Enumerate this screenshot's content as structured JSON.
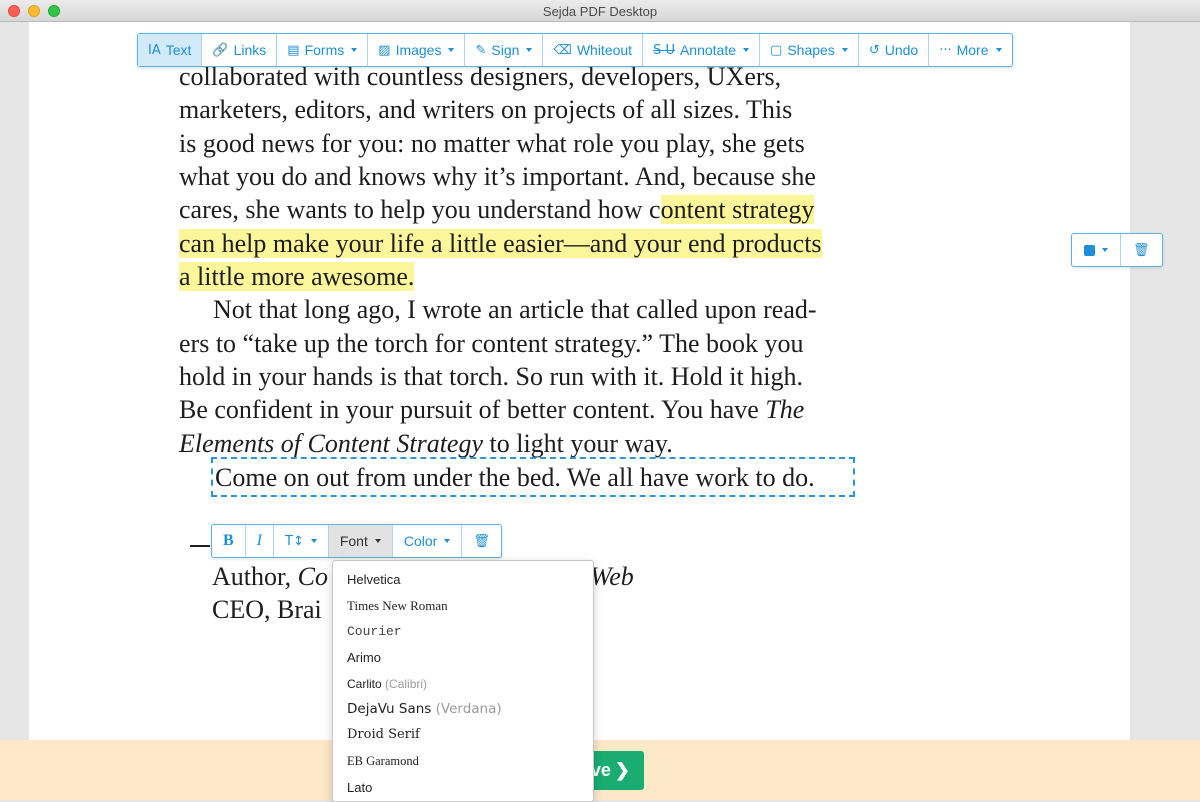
{
  "window": {
    "title": "Sejda PDF Desktop"
  },
  "toolbar": {
    "items": [
      {
        "label": "Text",
        "icon": "text-tool-icon",
        "glyph": "IA",
        "caret": false
      },
      {
        "label": "Links",
        "icon": "link-icon",
        "glyph": "🔗",
        "caret": false
      },
      {
        "label": "Forms",
        "icon": "form-icon",
        "glyph": "▤",
        "caret": true
      },
      {
        "label": "Images",
        "icon": "image-icon",
        "glyph": "▨",
        "caret": true
      },
      {
        "label": "Sign",
        "icon": "sign-icon",
        "glyph": "✎",
        "caret": true
      },
      {
        "label": "Whiteout",
        "icon": "eraser-icon",
        "glyph": "⌫",
        "caret": false
      },
      {
        "label": "Annotate",
        "icon": "strikethrough-icon",
        "glyph": "S U",
        "caret": true
      },
      {
        "label": "Shapes",
        "icon": "shapes-icon",
        "glyph": "▢",
        "caret": true
      },
      {
        "label": "Undo",
        "icon": "undo-icon",
        "glyph": "↺",
        "caret": false
      },
      {
        "label": "More",
        "icon": "more-icon",
        "glyph": "···",
        "caret": true
      }
    ]
  },
  "document": {
    "lines": [
      "collaborated with countless designers, developers, UXers,",
      "marketers, editors, and writers on projects of all sizes. This",
      "is good news for you: no matter what role you play, she gets",
      "what you do and knows why it’s important. And, because she"
    ],
    "line5_plain": "cares, she wants to help you understand how c",
    "line5_highlight": "ontent strategy",
    "line6_highlight": "can help make your life a little easier—and your end products",
    "line7_highlight": "a little more awesome.",
    "para2": [
      "Not that long ago, I wrote an article that called upon read-",
      "ers to “take up the torch for content strategy.” The book you",
      "hold in your hands is that torch. So run with it. Hold it high."
    ],
    "line11_plain": "Be confident in your pursuit of better content. You have ",
    "line11_italic": "The",
    "line12_italic": "Elements of Content Strategy",
    "line12_plain": " to light your way.",
    "selected_line": "Come on out from under the bed. We all have work to do.",
    "author_prefix": "Author, ",
    "author_italic": "Co",
    "author_suffix": "Web",
    "ceo_line": "CEO, Brai"
  },
  "format_toolbar": {
    "bold": "B",
    "italic": "I",
    "size": "T↕",
    "font": "Font",
    "color": "Color"
  },
  "font_dropdown": {
    "items": [
      {
        "name": "Helvetica",
        "alt": ""
      },
      {
        "name": "Times New Roman",
        "alt": ""
      },
      {
        "name": "Courier",
        "alt": ""
      },
      {
        "name": "Arimo",
        "alt": ""
      },
      {
        "name": "Carlito",
        "alt": "(Calibri)"
      },
      {
        "name": "DejaVu Sans",
        "alt": "(Verdana)"
      },
      {
        "name": "Droid Serif",
        "alt": ""
      },
      {
        "name": "EB Garamond",
        "alt": ""
      },
      {
        "name": "Lato",
        "alt": ""
      }
    ]
  },
  "apply_button": {
    "label": "ve",
    "chevron": "❯"
  },
  "colors": {
    "accent": "#1e8fd6",
    "highlight": "#fbf69a",
    "apply": "#1aad72",
    "bottom_bar": "#fde8c7"
  }
}
